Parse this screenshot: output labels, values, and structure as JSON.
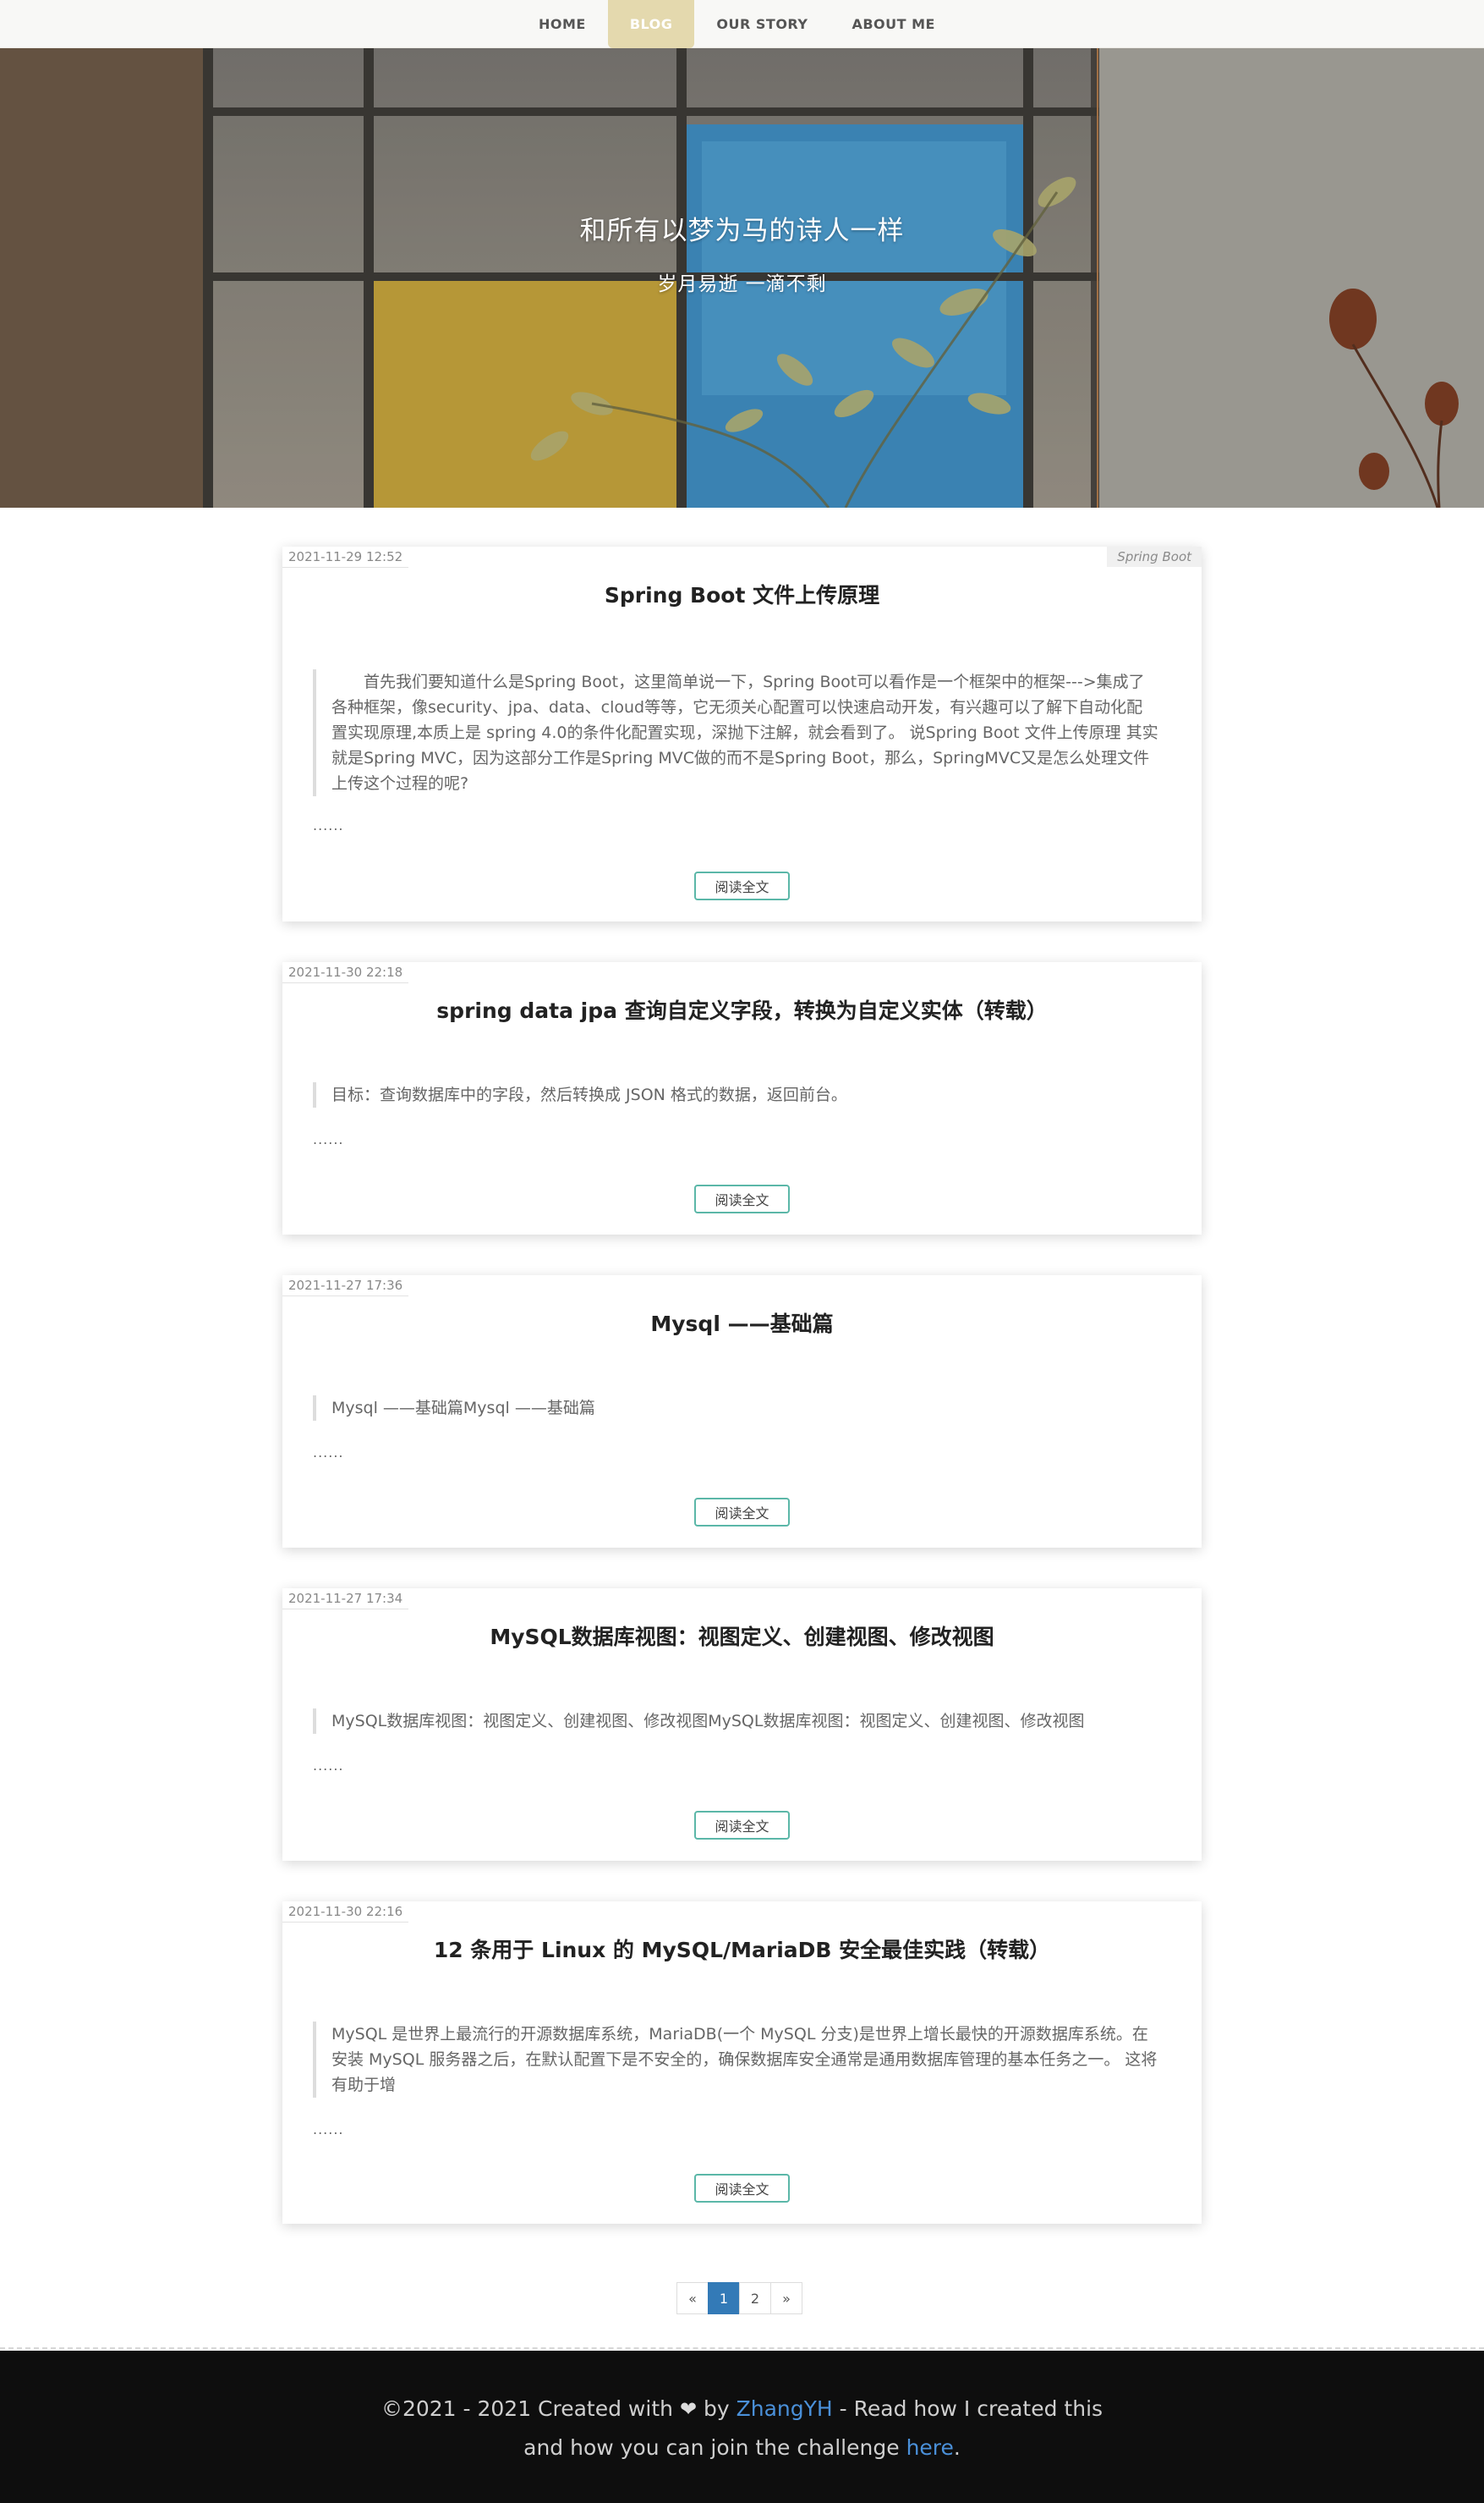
{
  "nav": {
    "items": [
      {
        "label": "HOME",
        "active": false
      },
      {
        "label": "BLOG",
        "active": true
      },
      {
        "label": "OUR STORY",
        "active": false
      },
      {
        "label": "ABOUT ME",
        "active": false
      }
    ]
  },
  "hero": {
    "title": "和所有以梦为马的诗人一样",
    "subtitle": "岁月易逝 一滴不剩"
  },
  "posts": [
    {
      "date": "2021-11-29 12:52",
      "tag": "Spring Boot",
      "title": "Spring Boot 文件上传原理",
      "excerpt": "首先我们要知道什么是Spring Boot，这里简单说一下，Spring Boot可以看作是一个框架中的框架--->集成了各种框架，像security、jpa、data、cloud等等，它无须关心配置可以快速启动开发，有兴趣可以了解下自动化配置实现原理,本质上是 spring 4.0的条件化配置实现，深抛下注解，就会看到了。 说Spring Boot 文件上传原理 其实就是Spring MVC，因为这部分工作是Spring MVC做的而不是Spring Boot，那么，SpringMVC又是怎么处理文件上传这个过程的呢?",
      "more": "......",
      "read_label": "阅读全文"
    },
    {
      "date": "2021-11-30 22:18",
      "tag": "",
      "title": "spring data jpa 查询自定义字段，转换为自定义实体（转载）",
      "excerpt": "目标：查询数据库中的字段，然后转换成 JSON 格式的数据，返回前台。",
      "more": "......",
      "read_label": "阅读全文"
    },
    {
      "date": "2021-11-27 17:36",
      "tag": "",
      "title": "Mysql ——基础篇",
      "excerpt": "Mysql ——基础篇Mysql ——基础篇",
      "more": "......",
      "read_label": "阅读全文"
    },
    {
      "date": "2021-11-27 17:34",
      "tag": "",
      "title": "MySQL数据库视图：视图定义、创建视图、修改视图",
      "excerpt": "MySQL数据库视图：视图定义、创建视图、修改视图MySQL数据库视图：视图定义、创建视图、修改视图",
      "more": "......",
      "read_label": "阅读全文"
    },
    {
      "date": "2021-11-30 22:16",
      "tag": "",
      "title": "12 条用于 Linux 的 MySQL/MariaDB 安全最佳实践（转载）",
      "excerpt": "MySQL 是世界上最流行的开源数据库系统，MariaDB(一个 MySQL 分支)是世界上增长最快的开源数据库系统。在安装 MySQL 服务器之后，在默认配置下是不安全的，确保数据库安全通常是通用数据库管理的基本任务之一。 这将有助于增",
      "more": "......",
      "read_label": "阅读全文"
    }
  ],
  "pagination": {
    "prev": "«",
    "pages": [
      "1",
      "2"
    ],
    "current": "1",
    "next": "»"
  },
  "footer": {
    "prefix": "©2021 - 2021 Created with",
    "by": "by",
    "author": "ZhangYH",
    "middle": "- Read how I created this and how you can join the challenge",
    "link": "here",
    "suffix": "."
  },
  "colors": {
    "accent_nav": "#e4d9ae",
    "button_border": "#5bb7a8",
    "page_active": "#337ab7",
    "footer_bg": "#0e0e0e",
    "footer_link": "#4a90d9"
  }
}
